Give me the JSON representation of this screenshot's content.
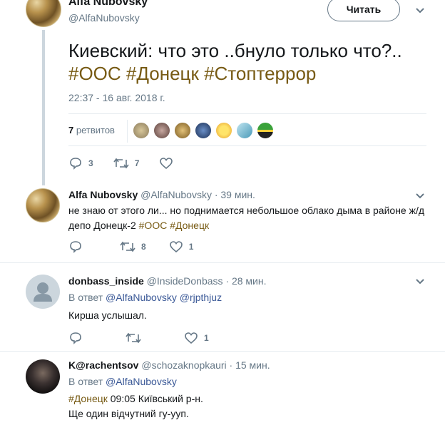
{
  "main_tweet": {
    "author_name": "Alfa Nubovsky",
    "author_handle": "@AlfaNubovsky",
    "follow_label": "Читать",
    "text_plain": "Киевский: что это ..бнуло только что?.. ",
    "hashtags": [
      "#ООС",
      "#Донецк",
      "#Стоптеррор"
    ],
    "timestamp": "22:37 - 16 авг. 2018 г.",
    "retweets_count": "7",
    "retweets_label": "ретвитов",
    "actions": {
      "replies": "3",
      "retweets": "7",
      "likes": ""
    }
  },
  "replies": [
    {
      "author_name": "Alfa Nubovsky",
      "author_handle": "@AlfaNubovsky",
      "time": "· 39 мин.",
      "text_plain_1": "не знаю от этого ли... но поднимается небольшое облако дыма в районе ж/д",
      "text_plain_2": "депо Донецк-2 ",
      "hashtags": [
        "#ООС",
        "#Донецк"
      ],
      "actions": {
        "replies": "",
        "retweets": "8",
        "likes": "1"
      }
    },
    {
      "author_name": "donbass_inside",
      "author_handle": "@InsideDonbass",
      "time": "· 28 мин.",
      "reply_to_prefix": "В ответ",
      "reply_to_users": [
        "@AlfaNubovsky",
        "@rjpthjuz"
      ],
      "text": "Кирша услышал.",
      "actions": {
        "replies": "",
        "retweets": "",
        "likes": "1"
      }
    },
    {
      "author_name": "K@rachentsov",
      "author_handle": "@schozaknopkauri",
      "time": "· 15 мин.",
      "reply_to_prefix": "В ответ",
      "reply_to_users": [
        "@AlfaNubovsky"
      ],
      "hashtag": "#Донецк",
      "text_line_1": " 09:05 Київський р-н.",
      "text_line_2": "Ще один відчутний гу-ууп."
    }
  ],
  "icons": {
    "reply": "reply-icon",
    "retweet": "retweet-icon",
    "like": "heart-icon",
    "menu": "chevron-down-icon"
  },
  "colors": {
    "hashtag": "#775a13",
    "mention": "#3b5997",
    "muted": "#657786",
    "text": "#14171a",
    "divider": "#e6ecf0"
  }
}
